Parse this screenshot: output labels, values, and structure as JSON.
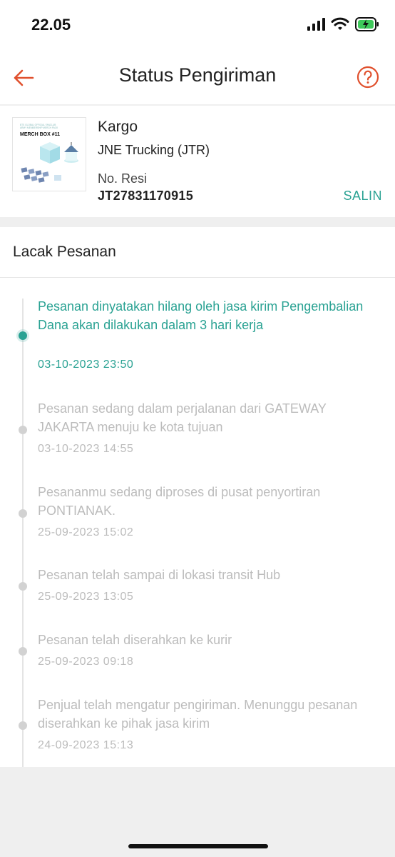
{
  "status_bar": {
    "time": "22.05"
  },
  "header": {
    "title": "Status Pengiriman"
  },
  "product_image": {
    "lines": [
      "BTS GLOBAL OFFICIAL FANCLUB",
      "ARMY MEMBERSHIP MERCH PACK",
      "MERCH BOX #11"
    ]
  },
  "shipment": {
    "type": "Kargo",
    "courier": "JNE Trucking (JTR)",
    "resi_label": "No. Resi",
    "resi_number": "JT27831170915",
    "copy_label": "SALIN"
  },
  "tracking": {
    "title": "Lacak Pesanan",
    "events": [
      {
        "description": "Pesanan dinyatakan hilang oleh jasa kirim Pengembalian Dana akan dilakukan dalam 3 hari kerja",
        "timestamp": "03-10-2023 23:50",
        "active": true
      },
      {
        "description": "Pesanan sedang dalam perjalanan dari GATEWAY JAKARTA menuju ke kota tujuan",
        "timestamp": "03-10-2023 14:55",
        "active": false
      },
      {
        "description": "Pesananmu sedang diproses di pusat penyortiran PONTIANAK.",
        "timestamp": "25-09-2023 15:02",
        "active": false
      },
      {
        "description": "Pesanan telah sampai di lokasi transit Hub",
        "timestamp": "25-09-2023 13:05",
        "active": false
      },
      {
        "description": "Pesanan telah diserahkan ke kurir",
        "timestamp": "25-09-2023 09:18",
        "active": false
      },
      {
        "description": "Penjual telah mengatur pengiriman. Menunggu pesanan diserahkan ke pihak jasa kirim",
        "timestamp": "24-09-2023 15:13",
        "active": false
      }
    ]
  },
  "colors": {
    "accent": "#2aa293",
    "brand": "#e0502d",
    "muted": "#bcbcbc"
  }
}
